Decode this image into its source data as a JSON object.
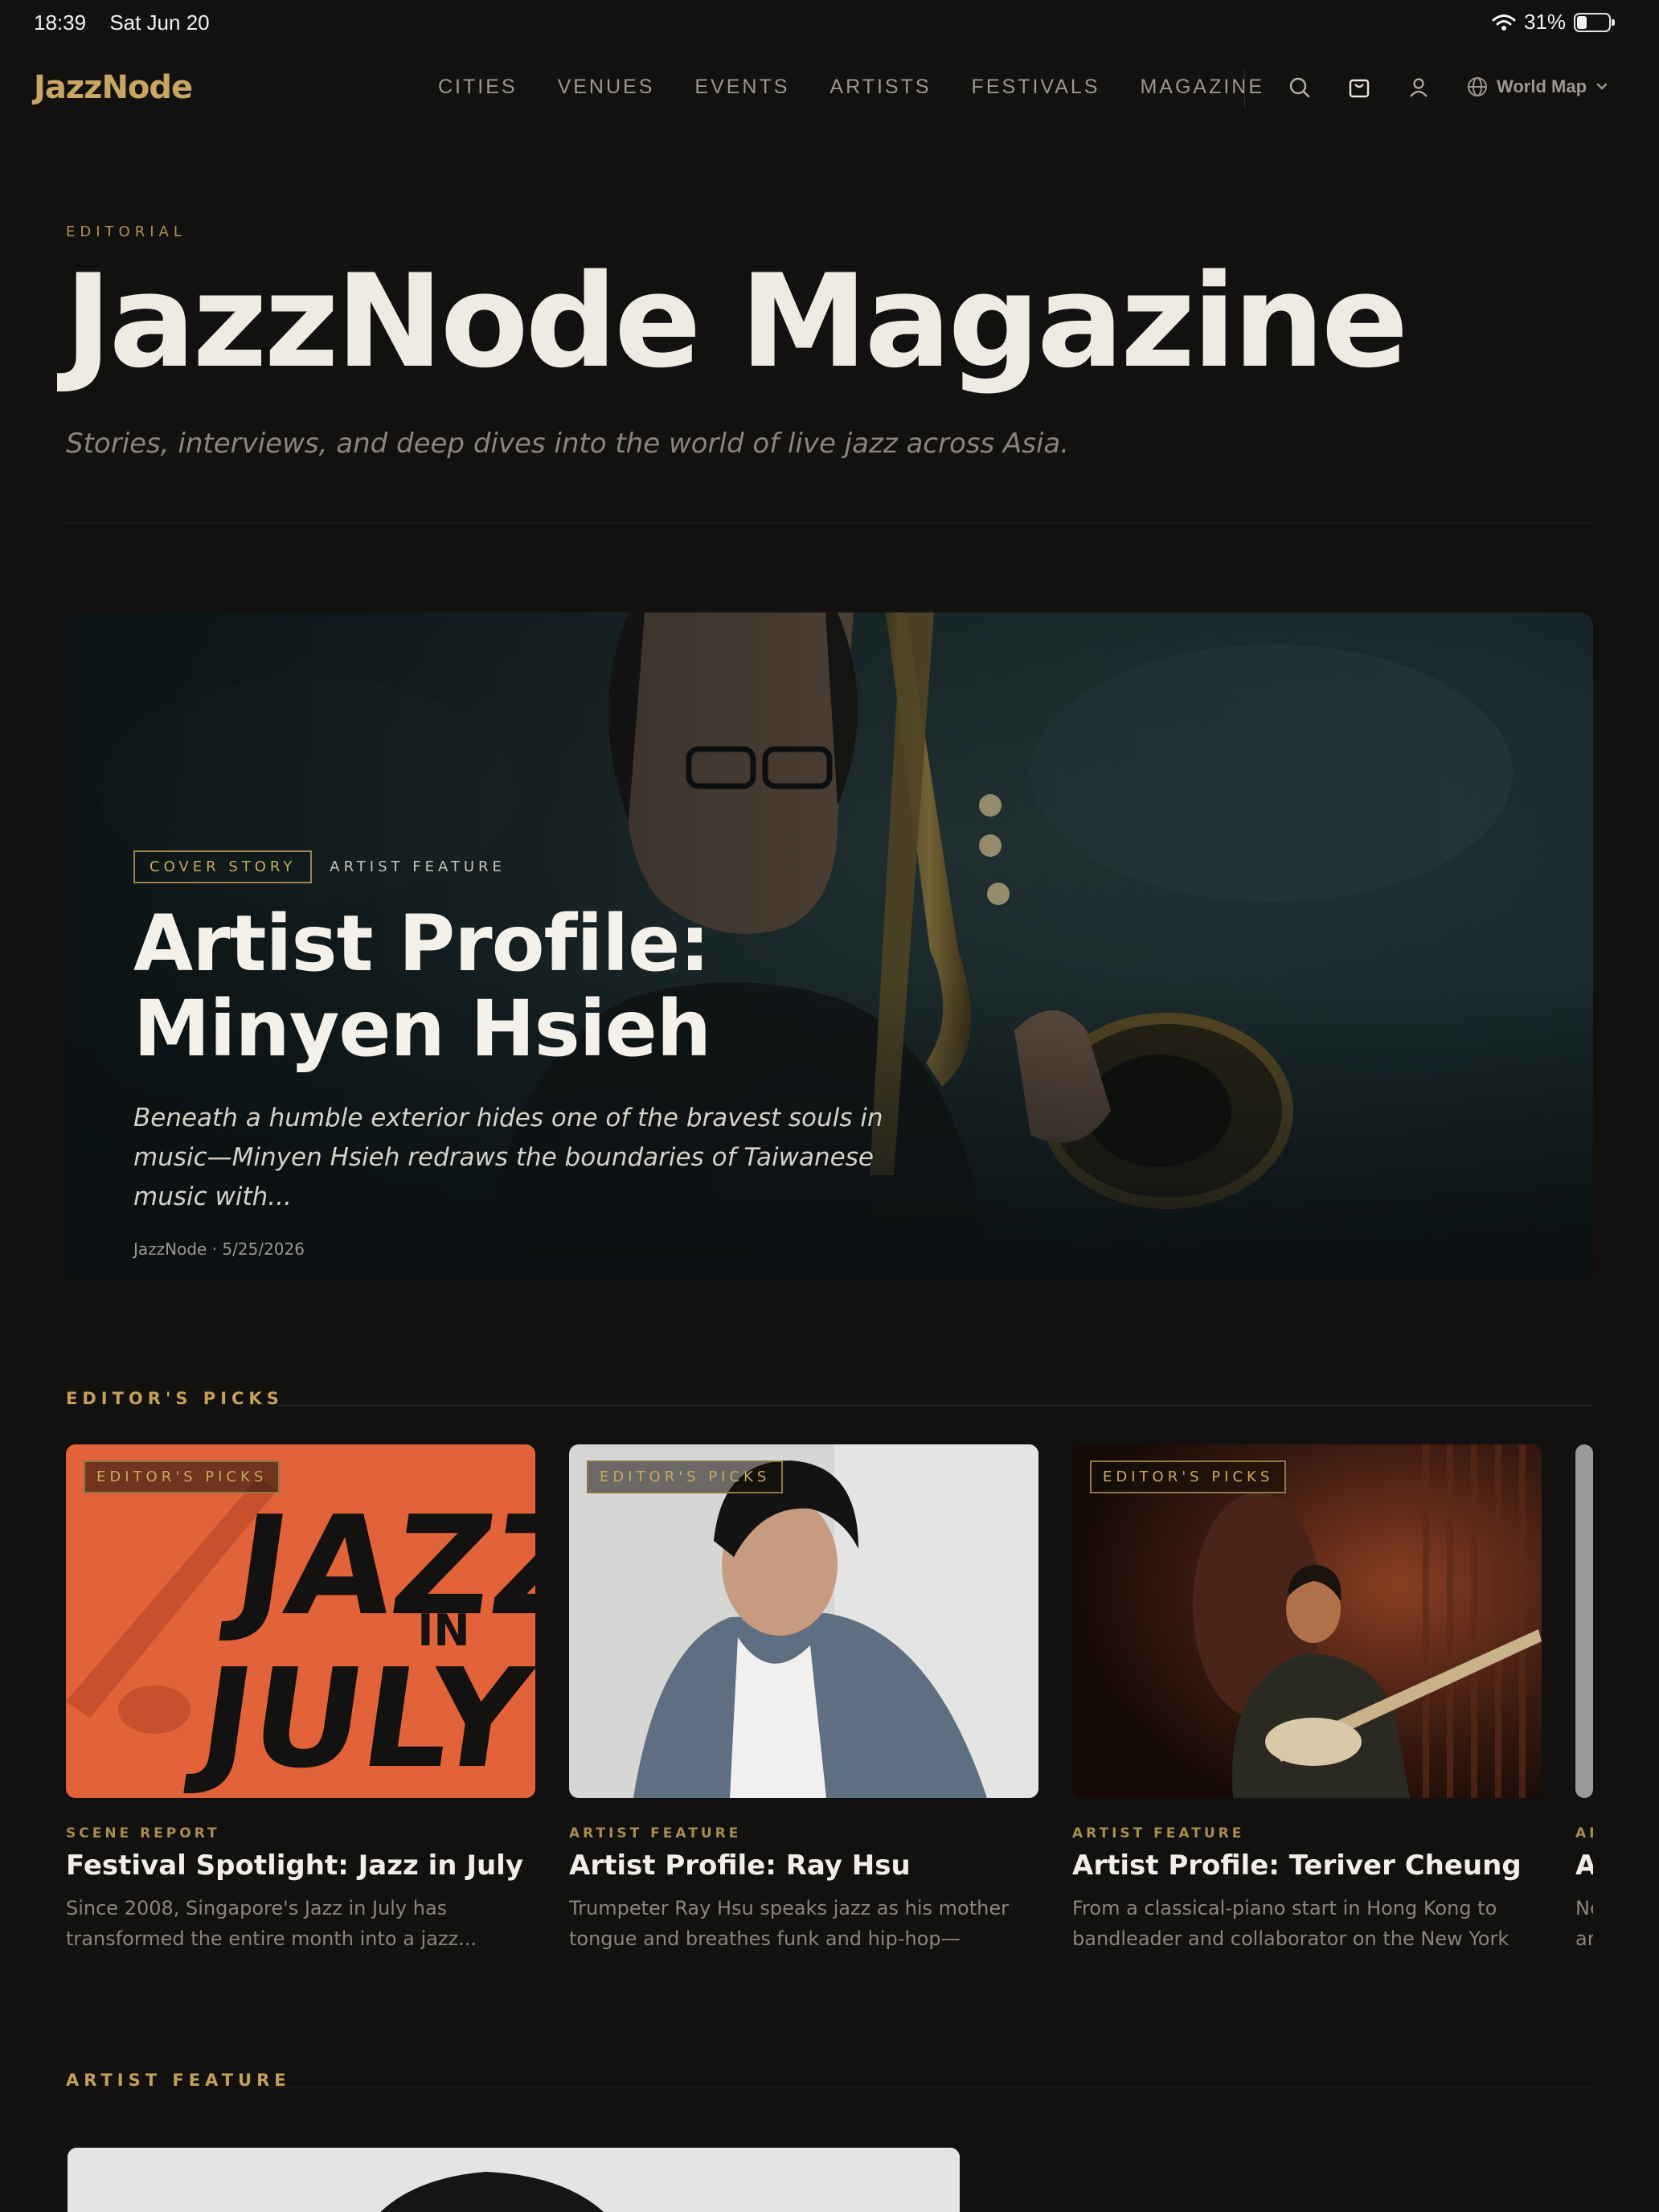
{
  "status_bar": {
    "time": "18:39",
    "date": "Sat Jun 20",
    "battery": "31%",
    "battery_level": 0.31
  },
  "nav": {
    "logo": "JazzNode",
    "links": [
      "CITIES",
      "VENUES",
      "EVENTS",
      "ARTISTS",
      "FESTIVALS",
      "MAGAZINE"
    ],
    "world_map": "World Map"
  },
  "header": {
    "eyebrow": "EDITORIAL",
    "title": "JazzNode Magazine",
    "subtitle": "Stories, interviews, and deep dives into the world of live jazz across Asia."
  },
  "hero": {
    "tag": "COVER STORY",
    "category": "ARTIST FEATURE",
    "title": "Artist Profile: Minyen Hsieh",
    "excerpt": "Beneath a humble exterior hides one of the bravest souls in music—Minyen Hsieh redraws the boundaries of Taiwanese music with...",
    "meta": "JazzNode · 5/25/2026"
  },
  "editors_picks": {
    "label": "EDITOR'S PICKS",
    "cards": [
      {
        "badge": "EDITOR'S PICKS",
        "category": "SCENE REPORT",
        "title": "Festival Spotlight: Jazz in July",
        "desc": "Since 2008, Singapore's Jazz in July has transformed the entire month into a jazz...",
        "art_text": [
          "JAZZ",
          "IN",
          "JULY"
        ]
      },
      {
        "badge": "EDITOR'S PICKS",
        "category": "ARTIST FEATURE",
        "title": "Artist Profile: Ray Hsu",
        "desc": "Trumpeter Ray Hsu speaks jazz as his mother tongue and breathes funk and hip-hop—making..."
      },
      {
        "badge": "EDITOR'S PICKS",
        "category": "ARTIST FEATURE",
        "title": "Artist Profile: Teriver Cheung",
        "desc": "From a classical-piano start in Hong Kong to bandleader and collaborator on the New York jaz..."
      },
      {
        "badge": "",
        "category": "AR",
        "title": "A",
        "desc": "Nc ar"
      }
    ]
  },
  "artist_feature": {
    "label": "ARTIST FEATURE"
  }
}
